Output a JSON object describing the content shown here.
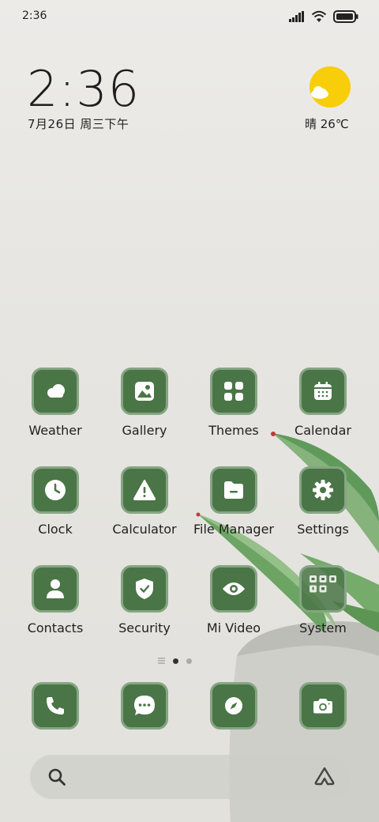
{
  "status_bar": {
    "time": "2:36"
  },
  "clock_widget": {
    "time": "2:36",
    "date": "7月26日 周三下午"
  },
  "weather_widget": {
    "text": "晴 26℃",
    "icon": "sun-cloud-icon"
  },
  "apps": [
    {
      "label": "Weather",
      "icon": "weather-icon"
    },
    {
      "label": "Gallery",
      "icon": "gallery-icon"
    },
    {
      "label": "Themes",
      "icon": "themes-icon"
    },
    {
      "label": "Calendar",
      "icon": "calendar-icon"
    },
    {
      "label": "Clock",
      "icon": "clock-icon"
    },
    {
      "label": "Calculator",
      "icon": "calculator-icon"
    },
    {
      "label": "File Manager",
      "icon": "file-manager-icon"
    },
    {
      "label": "Settings",
      "icon": "settings-icon"
    },
    {
      "label": "Contacts",
      "icon": "contacts-icon"
    },
    {
      "label": "Security",
      "icon": "security-icon"
    },
    {
      "label": "Mi Video",
      "icon": "mi-video-icon"
    },
    {
      "label": "System",
      "icon": "folder-icon"
    }
  ],
  "dock": [
    {
      "icon": "phone-icon"
    },
    {
      "icon": "messages-icon"
    },
    {
      "icon": "browser-icon"
    },
    {
      "icon": "camera-icon"
    }
  ],
  "colors": {
    "icon_bg": "#4a7546",
    "icon_border": "#86a583",
    "sun": "#f8cd0a"
  }
}
